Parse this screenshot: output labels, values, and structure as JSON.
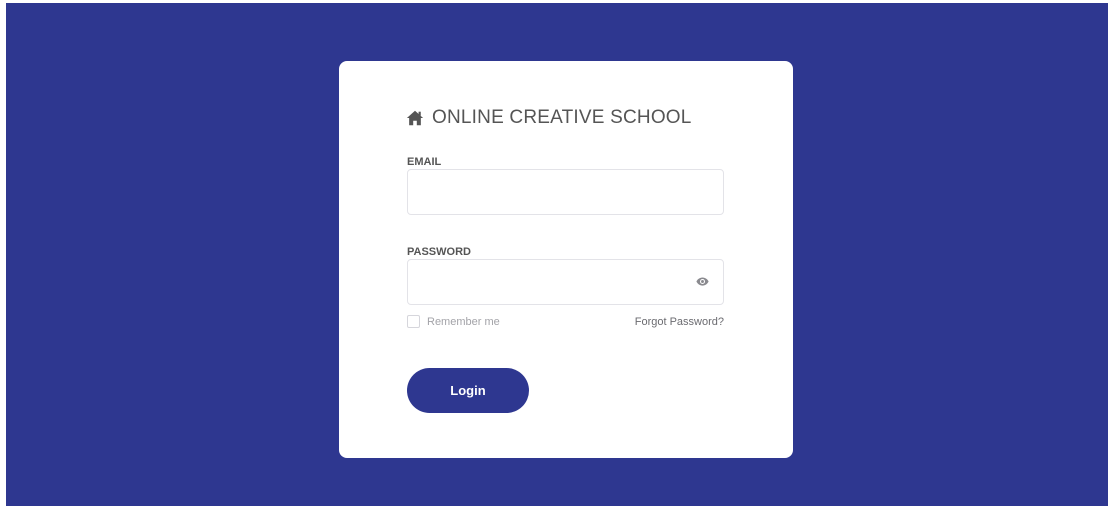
{
  "brand": {
    "icon": "home-icon",
    "title": "ONLINE CREATIVE SCHOOL"
  },
  "form": {
    "email_label": "EMAIL",
    "email_value": "",
    "password_label": "PASSWORD",
    "password_value": "",
    "password_toggle_icon": "eye-icon",
    "remember_label": "Remember me",
    "remember_checked": false,
    "forgot_link": "Forgot Password?",
    "login_label": "Login"
  },
  "colors": {
    "background": "#2e3790",
    "card": "#ffffff",
    "button": "#2e3790",
    "button_text": "#ffffff"
  }
}
